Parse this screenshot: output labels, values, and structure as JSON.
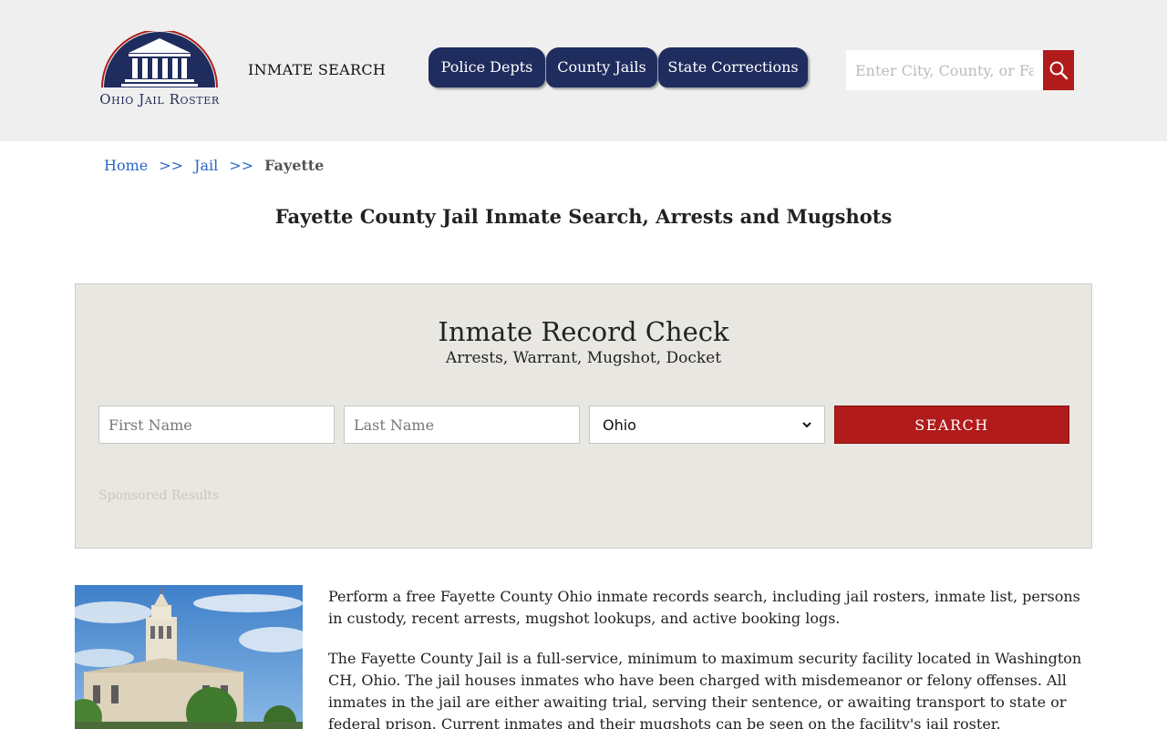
{
  "header": {
    "logo_text": "Ohio Jail Roster",
    "inmate_search_link": "INMATE SEARCH",
    "tabs": [
      {
        "label": "Police Depts"
      },
      {
        "label": "County Jails"
      },
      {
        "label": "State Corrections"
      }
    ],
    "search": {
      "placeholder": "Enter City, County, or Facility"
    }
  },
  "breadcrumb": {
    "home": "Home",
    "sep": ">>",
    "jail": "Jail",
    "current": "Fayette"
  },
  "page_title": "Fayette County Jail Inmate Search, Arrests and Mugshots",
  "record_check": {
    "title": "Inmate Record Check",
    "subtitle": "Arrests, Warrant, Mugshot, Docket",
    "first_name_placeholder": "First Name",
    "last_name_placeholder": "Last Name",
    "state_selected": "Ohio",
    "search_label": "SEARCH",
    "sponsored": "Sponsored Results"
  },
  "content": {
    "paragraphs": [
      "Perform a free Fayette County Ohio inmate records search, including jail rosters, inmate list, persons in custody, recent arrests, mugshot lookups, and active booking logs.",
      "The Fayette County Jail is a full-service, minimum to maximum security facility located in Washington CH, Ohio. The jail houses inmates who have been charged with misdemeanor or felony offenses. All inmates in the jail are either awaiting trial, serving their sentence, or awaiting transport to state or federal prison. Current inmates and their mugshots can be seen on the facility's jail roster."
    ]
  },
  "colors": {
    "nav": "#1f2c5e",
    "accent_red": "#b11b1b",
    "link": "#2a66c7",
    "header_bg": "#efefef",
    "box_bg": "#e9e7e1"
  },
  "icons": {
    "search_button": "search-icon",
    "select": "chevron-down-icon",
    "logo": "courthouse-logo-icon"
  }
}
